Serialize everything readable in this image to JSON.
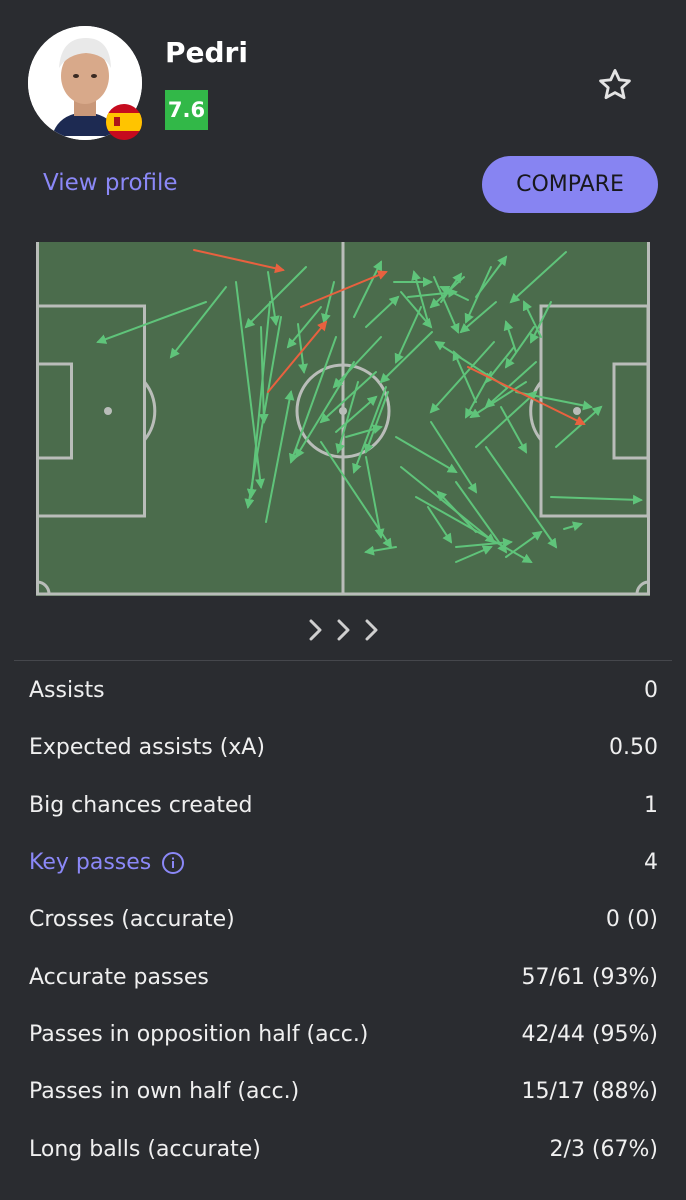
{
  "player": {
    "name": "Pedri",
    "rating": "7.6",
    "view_profile_label": "View profile",
    "compare_label": "COMPARE"
  },
  "colors": {
    "background": "#2a2c30",
    "accent": "#8784f2",
    "rating_badge": "#32b848",
    "pitch": "#4b6c4c",
    "pass_accurate": "#5fc47a",
    "pass_inaccurate": "#e8613f"
  },
  "icons": {
    "favorite": "star-outline-icon",
    "nationality": "spain-flag-icon",
    "more": "chevron-right-icon",
    "info": "info-circle-icon"
  },
  "stats": [
    {
      "label": "Assists",
      "value": "0"
    },
    {
      "label": "Expected assists (xA)",
      "value": "0.50"
    },
    {
      "label": "Big chances created",
      "value": "1"
    },
    {
      "label": "Key passes",
      "value": "4",
      "has_info": true
    },
    {
      "label": "Crosses (accurate)",
      "value": "0 (0)"
    },
    {
      "label": "Accurate passes",
      "value": "57/61 (93%)"
    },
    {
      "label": "Passes in opposition half (acc.)",
      "value": "42/44 (95%)"
    },
    {
      "label": "Passes in own half (acc.)",
      "value": "15/17 (88%)"
    },
    {
      "label": "Long balls (accurate)",
      "value": "2/3 (67%)"
    }
  ]
}
